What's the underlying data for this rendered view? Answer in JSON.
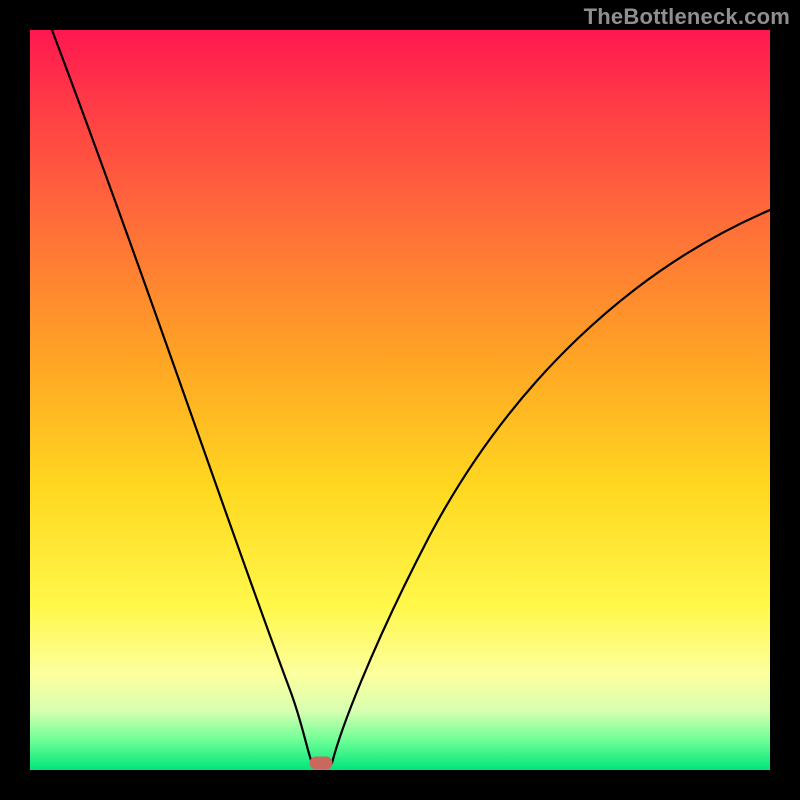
{
  "watermark": "TheBottleneck.com",
  "colors": {
    "frame": "#000000",
    "gradient_top": "#ff1750",
    "gradient_mid1": "#ff6a3a",
    "gradient_mid2": "#ffd820",
    "gradient_mid3": "#fdff9e",
    "gradient_bottom": "#00e57a",
    "curve": "#000000",
    "marker": "#c9695e",
    "watermark_text": "#8f8f8f"
  },
  "chart_data": {
    "type": "line",
    "title": "",
    "xlabel": "",
    "ylabel": "",
    "xlim": [
      0,
      100
    ],
    "ylim": [
      0,
      100
    ],
    "grid": false,
    "legend": false,
    "series": [
      {
        "name": "bottleneck-curve",
        "x": [
          3,
          10,
          15,
          20,
          25,
          30,
          33,
          36,
          37.5,
          40,
          43,
          47,
          55,
          65,
          75,
          85,
          95,
          100
        ],
        "values": [
          100,
          81,
          68,
          55,
          41,
          26,
          15,
          5,
          0.5,
          0.5,
          6,
          14,
          27,
          39,
          48,
          55,
          60,
          62
        ]
      }
    ],
    "marker": {
      "x": 39,
      "y": 0.5,
      "shape": "rounded-rect"
    },
    "color_scale_note": "background encodes value: red=high bottleneck, green=low"
  }
}
